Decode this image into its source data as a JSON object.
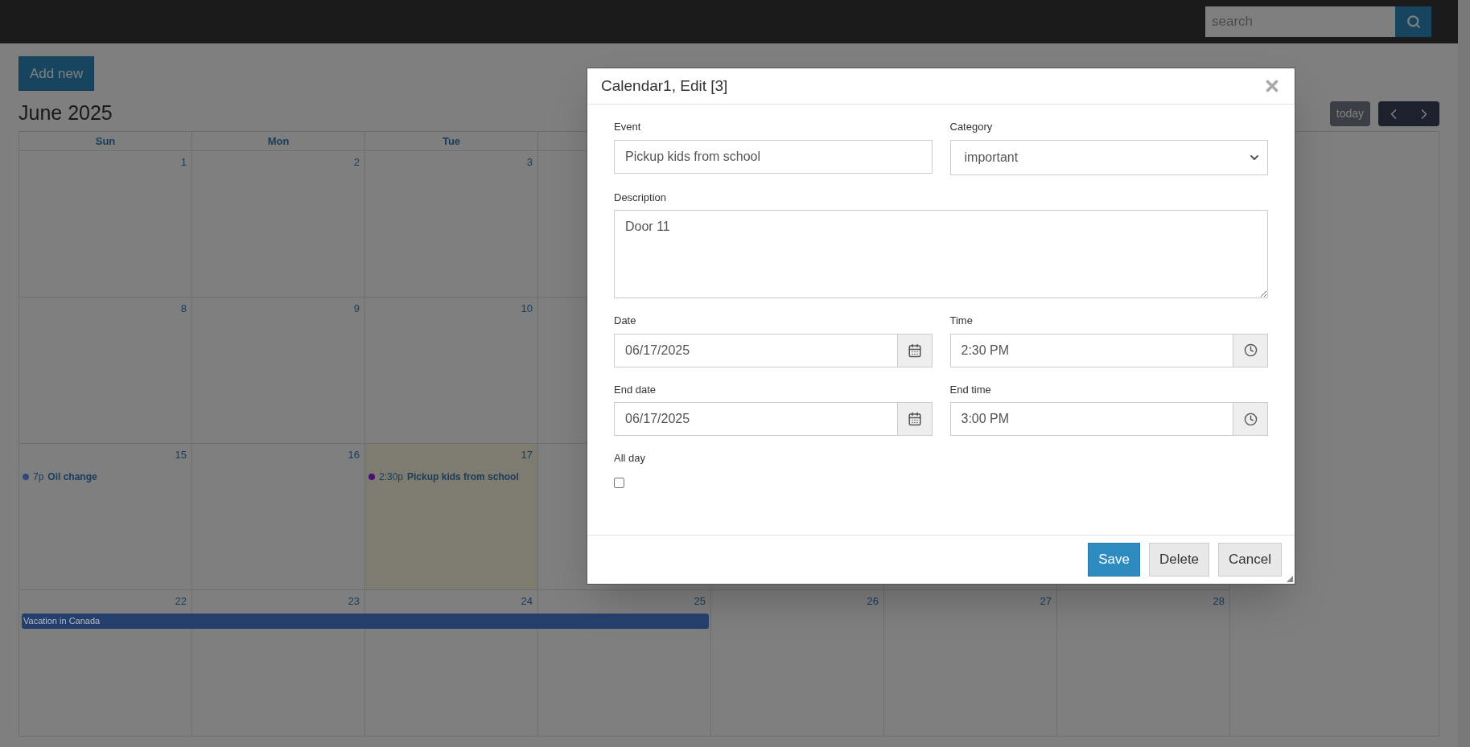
{
  "top_bar": {
    "search": {
      "placeholder": "search"
    }
  },
  "add_button": "Add new",
  "calendar": {
    "title": "June 2025",
    "today_button": "today",
    "weekdays": [
      {
        "label": "Sun"
      },
      {
        "label": "Mon"
      },
      {
        "label": "Tue"
      }
    ],
    "weeks": [
      {
        "days": [
          {
            "day": "1",
            "today": false
          },
          {
            "day": "2",
            "today": false
          },
          {
            "day": "3",
            "today": false
          }
        ]
      },
      {
        "days": [
          {
            "day": "8",
            "today": false
          },
          {
            "day": "9",
            "today": false
          },
          {
            "day": "10",
            "today": false
          }
        ]
      },
      {
        "days": [
          {
            "day": "15",
            "today": false,
            "events": [
              {
                "time": "7p",
                "title": "Oil change",
                "color": "#2c4a7e"
              }
            ]
          },
          {
            "day": "16",
            "today": false
          },
          {
            "day": "17",
            "today": true,
            "events": [
              {
                "time": "2:30p",
                "title": "Pickup kids from school",
                "color": "#4b0d7a"
              }
            ]
          }
        ]
      },
      {
        "days": [
          {
            "day": "22",
            "today": false
          },
          {
            "day": "23",
            "today": false
          },
          {
            "day": "24",
            "today": false
          },
          {
            "day": "25",
            "today": false
          },
          {
            "day": "26",
            "today": false
          },
          {
            "day": "27",
            "today": false
          },
          {
            "day": "28",
            "today": false
          }
        ],
        "all_day_events": [
          {
            "title": "Vacation in Canada",
            "color": "#253f6c"
          }
        ]
      }
    ]
  },
  "dialog": {
    "title": "Calendar1, Edit [3]",
    "event": {
      "label": "Event",
      "value": "Pickup kids from school"
    },
    "category": {
      "label": "Category",
      "value": "important"
    },
    "description": {
      "label": "Description",
      "value": "Door 11"
    },
    "date": {
      "label": "Date",
      "value": "06/17/2025"
    },
    "time": {
      "label": "Time",
      "value": "2:30 PM"
    },
    "end_date": {
      "label": "End date",
      "value": "06/17/2025"
    },
    "end_time": {
      "label": "End time",
      "value": "3:00 PM"
    },
    "all_day": {
      "label": "All day",
      "checked": false
    },
    "buttons": [
      {
        "label": "Save",
        "kind": "primary"
      },
      {
        "label": "Delete",
        "kind": "default"
      },
      {
        "label": "Cancel",
        "kind": "default"
      }
    ]
  }
}
